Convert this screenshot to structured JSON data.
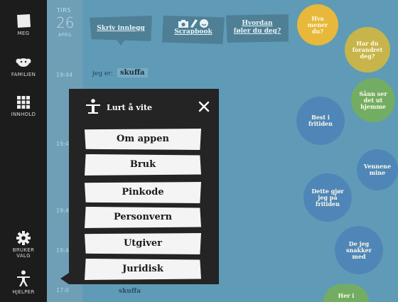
{
  "nav": {
    "items": [
      {
        "label": "MEG",
        "icon": "square-icon"
      },
      {
        "label": "FAMILIEN",
        "icon": "family-icon"
      },
      {
        "label": "INNHOLD",
        "icon": "grid-icon"
      },
      {
        "label": "BRUKER\nVALG",
        "icon": "gear-icon"
      },
      {
        "label": "HJELPER",
        "icon": "helper-person-icon"
      }
    ]
  },
  "date": {
    "weekday": "TIRS",
    "day": "26",
    "month": "APRIL"
  },
  "timeline": {
    "times": [
      "19:44",
      "19:4",
      "19:4",
      "19:4",
      "17:0"
    ]
  },
  "toolbar": {
    "write_label": "Skriv innlegg",
    "scrapbook_label": "Scrapbook",
    "feeling_line1": "Hvordan",
    "feeling_line2": "føler du deg?"
  },
  "status": {
    "prefix": "Jeg er:",
    "value": "skuffa"
  },
  "feed": {
    "stub": "skuffa"
  },
  "bubbles": [
    {
      "text": "Hva mener du?",
      "color": "#e7b83a"
    },
    {
      "text": "Har du forandret deg?",
      "color": "#c7b54b"
    },
    {
      "text": "Sånn ser det ut hjemme",
      "color": "#73ad63"
    },
    {
      "text": "Best i fritiden",
      "color": "#4f86b8"
    },
    {
      "text": "Vennene mine",
      "color": "#4f86b8"
    },
    {
      "text": "Dette gjør jeg på fritiden",
      "color": "#4f86b8"
    },
    {
      "text": "De jeg snakker med",
      "color": "#4f86b8"
    },
    {
      "text": "Her i",
      "color": "#73ad63"
    }
  ],
  "panel": {
    "title": "Lurt å vite",
    "items": [
      "Om appen",
      "Bruk",
      "Pinkode",
      "Personvern",
      "Utgiver",
      "Juridisk"
    ]
  },
  "colors": {
    "main_bg": "#5f9bb6",
    "nav_bg": "#1c1c1c",
    "panel_bg": "#242424",
    "button_bg": "#f4f4f4"
  }
}
